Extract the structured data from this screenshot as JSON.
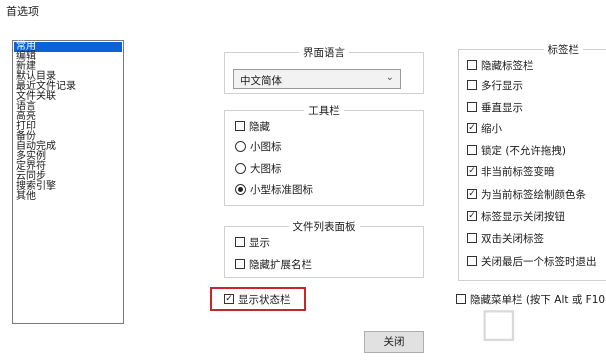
{
  "window": {
    "title": "首选项"
  },
  "categories": {
    "items": [
      "常用",
      "编辑",
      "新建",
      "默认目录",
      "最近文件记录",
      "文件关联",
      "语言",
      "高亮",
      "打印",
      "备份",
      "自动完成",
      "多实例",
      "定界符",
      "云同步",
      "搜索引擎",
      "其他"
    ],
    "selected": "常用"
  },
  "ui_language": {
    "title": "界面语言",
    "value": "中文简体"
  },
  "toolbar": {
    "title": "工具栏",
    "hide_label": "隐藏",
    "hide_checked": false,
    "options": [
      "小图标",
      "大图标",
      "小型标准图标"
    ],
    "selected": "小型标准图标"
  },
  "file_list_panel": {
    "title": "文件列表面板",
    "show_label": "显示",
    "show_checked": false,
    "hide_ext_label": "隐藏扩展名栏",
    "hide_ext_checked": false
  },
  "status_bar": {
    "label": "显示状态栏",
    "checked": true
  },
  "tab_bar": {
    "title": "标签栏",
    "options": [
      {
        "label": "隐藏标签栏",
        "checked": false
      },
      {
        "label": "多行显示",
        "checked": false
      },
      {
        "label": "垂直显示",
        "checked": false
      },
      {
        "label": "缩小",
        "checked": true
      },
      {
        "label": "锁定 (不允许拖拽)",
        "checked": false
      },
      {
        "label": "非当前标签变暗",
        "checked": true
      },
      {
        "label": "为当前标签绘制颜色条",
        "checked": true
      },
      {
        "label": "标签显示关闭按钮",
        "checked": true
      },
      {
        "label": "双击关闭标签",
        "checked": false
      },
      {
        "label": "关闭最后一个标签时退出",
        "checked": false
      }
    ]
  },
  "menubar": {
    "label": "隐藏菜单栏 (按下 Alt 或 F10",
    "checked": false
  },
  "buttons": {
    "close": "关闭"
  },
  "colors": {
    "selection": "#0a64d6",
    "highlight_border": "#c8262b"
  }
}
